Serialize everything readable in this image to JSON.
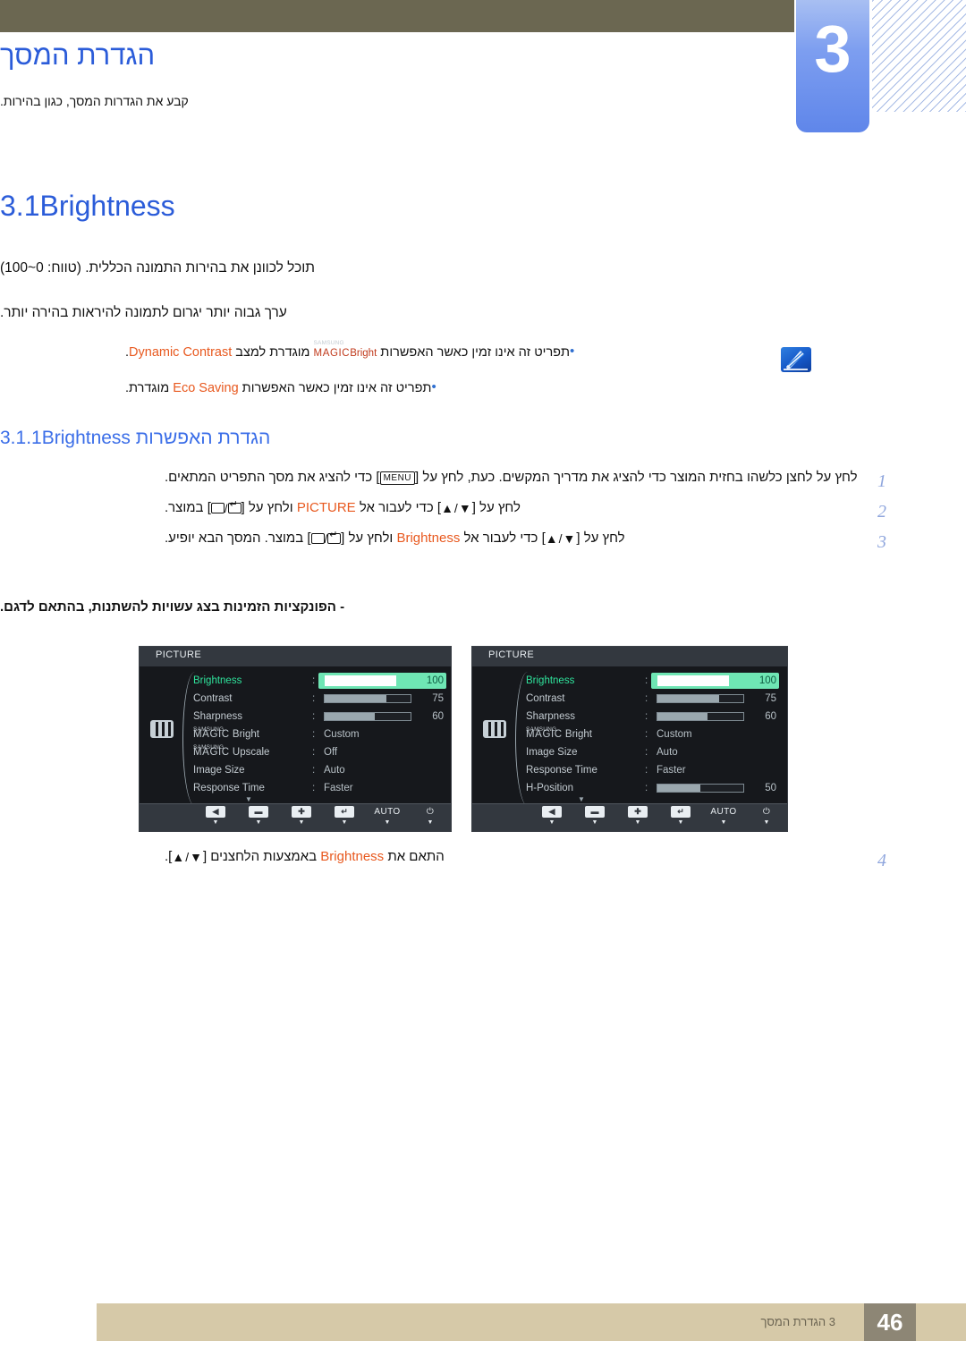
{
  "header": {
    "chapter_number": "3",
    "chapter_title": "הגדרת המסך",
    "chapter_subtitle": "קבע את הגדרות המסך, כגון בהירות."
  },
  "section": {
    "number": "3.1",
    "name": "Brightness",
    "paragraph_1": "תוכל לכוונן את בהירות התמונה הכללית. (טווח: 0~100)",
    "paragraph_2": "ערך גבוה יותר יגרום לתמונה להיראות בהירה יותר."
  },
  "notes": {
    "icon_name": "note-pencil-icon",
    "bullets": [
      {
        "prefix": "תפריט זה אינו זמין כאשר האפשרות ",
        "magic_samsung": "SAMSUNG",
        "magic_word": "MAGIC",
        "magic_suffix": "Bright",
        "middle": " מוגדרת למצב ",
        "term": "Dynamic Contrast",
        "suffix": "."
      },
      {
        "prefix": "תפריט זה אינו זמין כאשר האפשרות ",
        "term": "Eco Saving",
        "suffix": " מוגדרת."
      }
    ]
  },
  "subsection": {
    "number": "3.1.1",
    "name_he": "הגדרת האפשרות ",
    "name_en": "Brightness"
  },
  "steps": [
    {
      "num": "1",
      "part_a": "לחץ על לחצן כלשהו בחזית המוצר כדי להציג את מדריך המקשים. כעת, לחץ על [",
      "key": "MENU",
      "part_b": "] כדי להציג את מסך התפריט המתאים."
    },
    {
      "num": "2",
      "part_a": "לחץ על [",
      "arrows": "▲/▼",
      "part_b": "] כדי לעבור אל ",
      "term": "PICTURE",
      "part_c": " ולחץ על [",
      "part_d": "] במוצר."
    },
    {
      "num": "3",
      "part_a": "לחץ על [",
      "arrows": "▲/▼",
      "part_b": "] כדי לעבור אל ",
      "term": "Brightness",
      "part_c": " ולחץ על [",
      "part_d": "] במוצר. המסך הבא יופיע."
    }
  ],
  "step4": {
    "num": "4",
    "part_a": "התאם את ",
    "term": "Brightness",
    "part_b": " באמצעות הלחצנים [",
    "arrows": "▲/▼",
    "part_c": "]."
  },
  "model_note": "- הפונקציות הזמינות בצג עשויות להשתנות, בהתאם לדגם.",
  "osd_left": {
    "title": "PICTURE",
    "side_icon": "picture-bars-icon",
    "rows": [
      {
        "label": "Brightness",
        "type": "slider",
        "value": "100",
        "fill": 82,
        "active": true
      },
      {
        "label": "Contrast",
        "type": "slider",
        "value": "75",
        "fill": 72,
        "active": false
      },
      {
        "label": "Sharpness",
        "type": "slider",
        "value": "60",
        "fill": 58,
        "active": false
      },
      {
        "label": "MAGIC Bright",
        "magic": true,
        "magic_samsung": "SAMSUNG",
        "magic_word": "MAGIC",
        "magic_rest": " Bright",
        "type": "value",
        "value": "Custom",
        "active": false
      },
      {
        "label": "MAGIC Upscale",
        "magic": true,
        "magic_samsung": "SAMSUNG",
        "magic_word": "MAGIC",
        "magic_rest": " Upscale",
        "type": "value",
        "value": "Off",
        "active": false
      },
      {
        "label": "Image Size",
        "type": "value",
        "value": "Auto",
        "active": false
      },
      {
        "label": "Response Time",
        "type": "value",
        "value": "Faster",
        "active": false
      }
    ],
    "more_indicator": "▼",
    "toolbar": [
      {
        "name": "back-button",
        "glyph": "◀",
        "caret": "▼"
      },
      {
        "name": "minus-button",
        "glyph": "▬",
        "caret": "▼"
      },
      {
        "name": "plus-button",
        "glyph": "✚",
        "caret": "▼"
      },
      {
        "name": "enter-button",
        "glyph": "↵",
        "caret": "▼"
      },
      {
        "name": "auto-button",
        "text": "AUTO",
        "caret": "▼"
      },
      {
        "name": "power-button",
        "text": "⏻",
        "caret": "▼"
      }
    ]
  },
  "osd_right": {
    "title": "PICTURE",
    "side_icon": "picture-bars-icon",
    "rows": [
      {
        "label": "Brightness",
        "type": "slider",
        "value": "100",
        "fill": 82,
        "active": true
      },
      {
        "label": "Contrast",
        "type": "slider",
        "value": "75",
        "fill": 72,
        "active": false
      },
      {
        "label": "Sharpness",
        "type": "slider",
        "value": "60",
        "fill": 58,
        "active": false
      },
      {
        "label": "MAGIC Bright",
        "magic": true,
        "magic_samsung": "SAMSUNG",
        "magic_word": "MAGIC",
        "magic_rest": " Bright",
        "type": "value",
        "value": "Custom",
        "active": false
      },
      {
        "label": "Image Size",
        "type": "value",
        "value": "Auto",
        "active": false
      },
      {
        "label": "Response Time",
        "type": "value",
        "value": "Faster",
        "active": false
      },
      {
        "label": "H-Position",
        "type": "slider",
        "value": "50",
        "fill": 50,
        "active": false
      }
    ],
    "more_indicator": "▼",
    "toolbar": [
      {
        "name": "back-button",
        "glyph": "◀",
        "caret": "▼"
      },
      {
        "name": "minus-button",
        "glyph": "▬",
        "caret": "▼"
      },
      {
        "name": "plus-button",
        "glyph": "✚",
        "caret": "▼"
      },
      {
        "name": "enter-button",
        "glyph": "↵",
        "caret": "▼"
      },
      {
        "name": "auto-button",
        "text": "AUTO",
        "caret": "▼"
      },
      {
        "name": "power-button",
        "text": "⏻",
        "caret": "▼"
      }
    ]
  },
  "footer": {
    "text": "3 הגדרת המסך",
    "page_number": "46"
  },
  "colors": {
    "accent_blue": "#2b5cd9",
    "sub_blue": "#3b6ee8",
    "orange": "#e8591f",
    "olive": "#6b6751",
    "tab_blue": "#7d9ef0",
    "footer_tan": "#d6c9a8",
    "footer_box": "#8d8675",
    "osd_green": "#6fe6b4",
    "magic_red": "#c0391b"
  }
}
